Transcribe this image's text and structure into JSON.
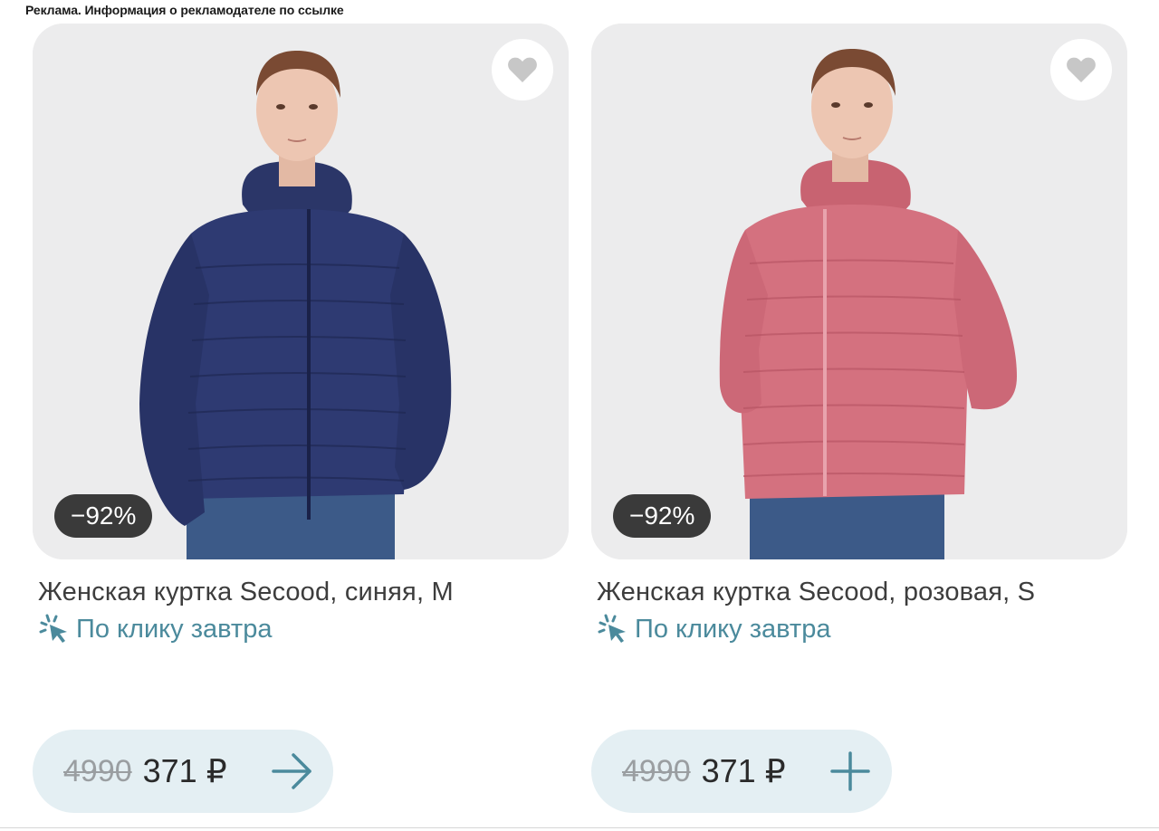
{
  "ad_notice": "Реклама. Информация о рекламодателе по ссылке",
  "colors": {
    "accent": "#4b8a9c",
    "badge_bg": "#3a3a3a",
    "pill_bg": "#e4eff3",
    "photo_bg": "#ececed",
    "jacket_left": "#2e3a72",
    "jacket_right": "#d4717f"
  },
  "products": [
    {
      "title": "Женская куртка Secood, синяя, M",
      "discount": "−92%",
      "delivery_icon": "sparkle-cursor-icon",
      "delivery": "По клику завтра",
      "old_price": "4990",
      "price": "371 ₽",
      "action_icon": "arrow-right-icon",
      "favorite_icon": "heart-icon"
    },
    {
      "title": "Женская куртка Secood, розовая, S",
      "discount": "−92%",
      "delivery_icon": "sparkle-cursor-icon",
      "delivery": "По клику завтра",
      "old_price": "4990",
      "price": "371 ₽",
      "action_icon": "plus-icon",
      "favorite_icon": "heart-icon"
    }
  ]
}
